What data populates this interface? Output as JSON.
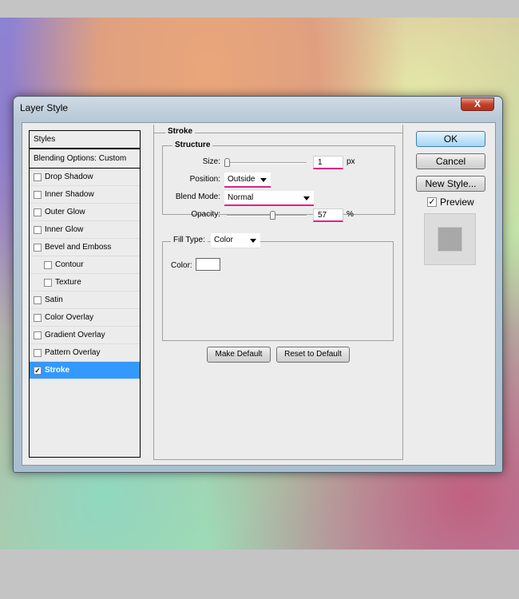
{
  "dialog": {
    "title": "Layer Style",
    "close_label": "X"
  },
  "styles_list": {
    "header": "Styles",
    "blending": "Blending Options: Custom",
    "items": [
      {
        "label": "Drop Shadow",
        "checked": false,
        "indent": false
      },
      {
        "label": "Inner Shadow",
        "checked": false,
        "indent": false
      },
      {
        "label": "Outer Glow",
        "checked": false,
        "indent": false
      },
      {
        "label": "Inner Glow",
        "checked": false,
        "indent": false
      },
      {
        "label": "Bevel and Emboss",
        "checked": false,
        "indent": false
      },
      {
        "label": "Contour",
        "checked": false,
        "indent": true
      },
      {
        "label": "Texture",
        "checked": false,
        "indent": true
      },
      {
        "label": "Satin",
        "checked": false,
        "indent": false
      },
      {
        "label": "Color Overlay",
        "checked": false,
        "indent": false
      },
      {
        "label": "Gradient Overlay",
        "checked": false,
        "indent": false
      },
      {
        "label": "Pattern Overlay",
        "checked": false,
        "indent": false
      },
      {
        "label": "Stroke",
        "checked": true,
        "indent": false,
        "selected": true
      }
    ]
  },
  "stroke": {
    "section_title": "Stroke",
    "structure_title": "Structure",
    "size_label": "Size:",
    "size_value": "1",
    "size_unit": "px",
    "size_slider_fraction": 0.0,
    "position_label": "Position:",
    "position_value": "Outside",
    "blend_label": "Blend Mode:",
    "blend_value": "Normal",
    "opacity_label": "Opacity:",
    "opacity_value": "57",
    "opacity_unit": "%",
    "opacity_fraction": 0.57,
    "fill_type_label": "Fill Type:",
    "fill_type_value": "Color",
    "color_label": "Color:",
    "color_swatch": "#ffffff",
    "make_default": "Make Default",
    "reset_default": "Reset to Default"
  },
  "buttons": {
    "ok": "OK",
    "cancel": "Cancel",
    "new_style": "New Style...",
    "preview_label": "Preview",
    "preview_checked": true
  },
  "colors": {
    "highlight": "#e0208a",
    "selection": "#3399ff"
  }
}
